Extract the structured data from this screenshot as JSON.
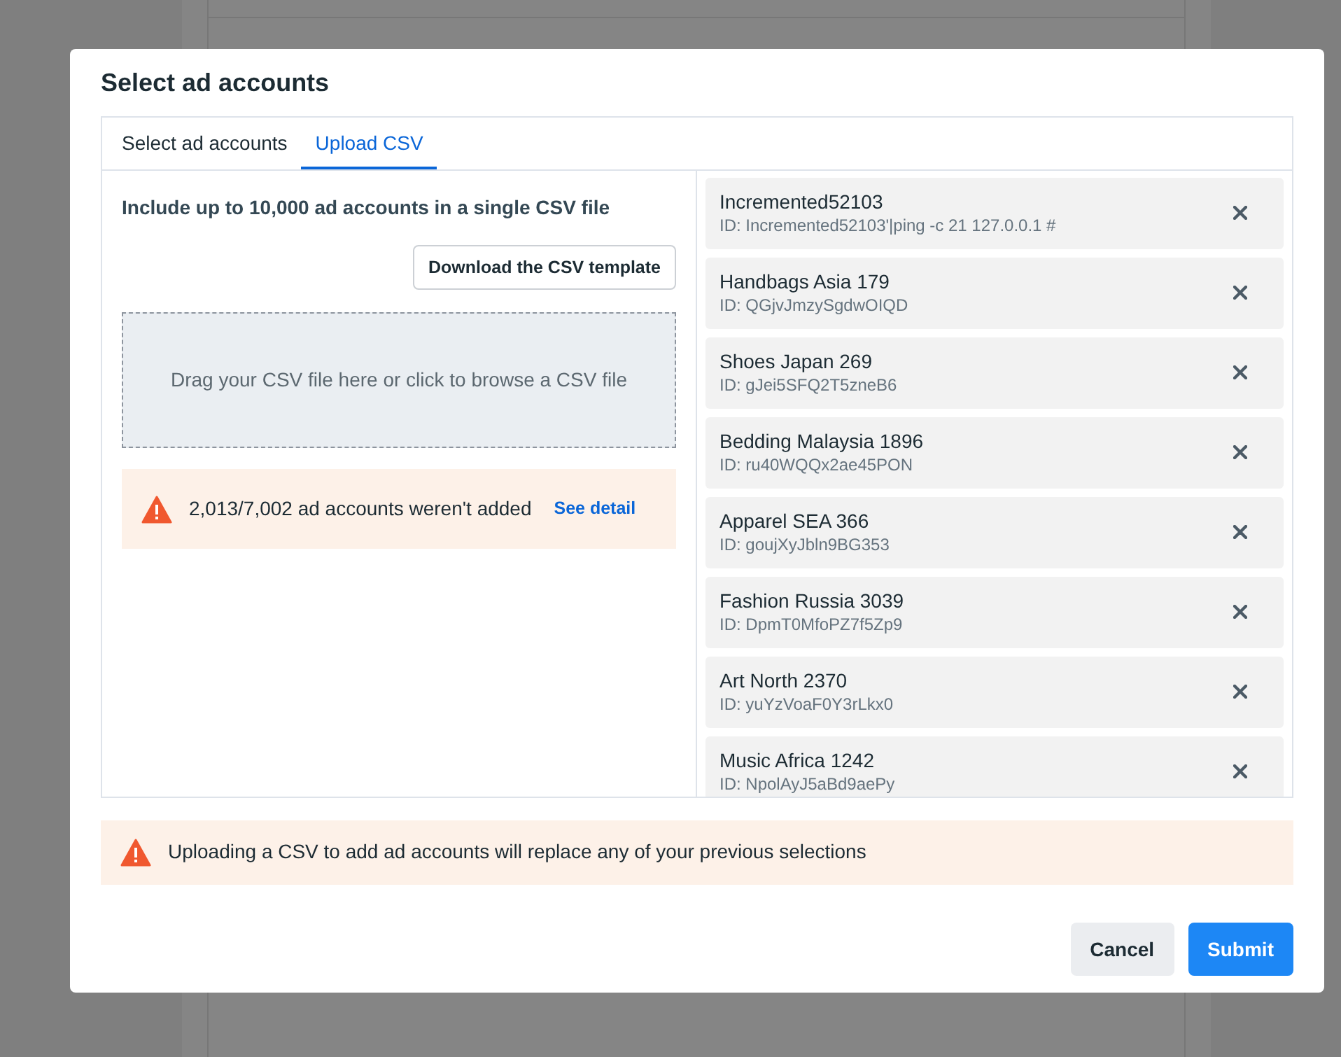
{
  "dialog": {
    "title": "Select ad accounts",
    "tabs": [
      {
        "label": "Select ad accounts",
        "selected": false
      },
      {
        "label": "Upload CSV",
        "selected": true
      }
    ],
    "upload": {
      "heading": "Include up to 10,000 ad accounts in a single CSV file",
      "template_button": "Download the CSV template",
      "dropzone": "Drag your CSV file here or click to browse a CSV file",
      "error": {
        "message": "2,013/7,002 ad accounts weren't added",
        "link": "See detail"
      }
    },
    "accounts": [
      {
        "name": "Incremented52103",
        "id": "ID: Incremented52103'|ping -c 21 127.0.0.1 #"
      },
      {
        "name": "Handbags Asia 179",
        "id": "ID: QGjvJmzySgdwOIQD"
      },
      {
        "name": "Shoes Japan 269",
        "id": "ID: gJei5SFQ2T5zneB6"
      },
      {
        "name": "Bedding Malaysia 1896",
        "id": "ID: ru40WQQx2ae45PON"
      },
      {
        "name": "Apparel SEA 366",
        "id": "ID: goujXyJbln9BG353"
      },
      {
        "name": "Fashion Russia 3039",
        "id": "ID: DpmT0MfoPZ7f5Zp9"
      },
      {
        "name": "Art North 2370",
        "id": "ID: yuYzVoaF0Y3rLkx0"
      },
      {
        "name": "Music Africa 1242",
        "id": "ID: NpolAyJ5aBd9aePy"
      }
    ],
    "warning": "Uploading a CSV to add ad accounts will replace any of your previous selections",
    "buttons": [
      {
        "label": "Cancel",
        "kind": "secondary"
      },
      {
        "label": "Submit",
        "kind": "primary"
      }
    ]
  }
}
